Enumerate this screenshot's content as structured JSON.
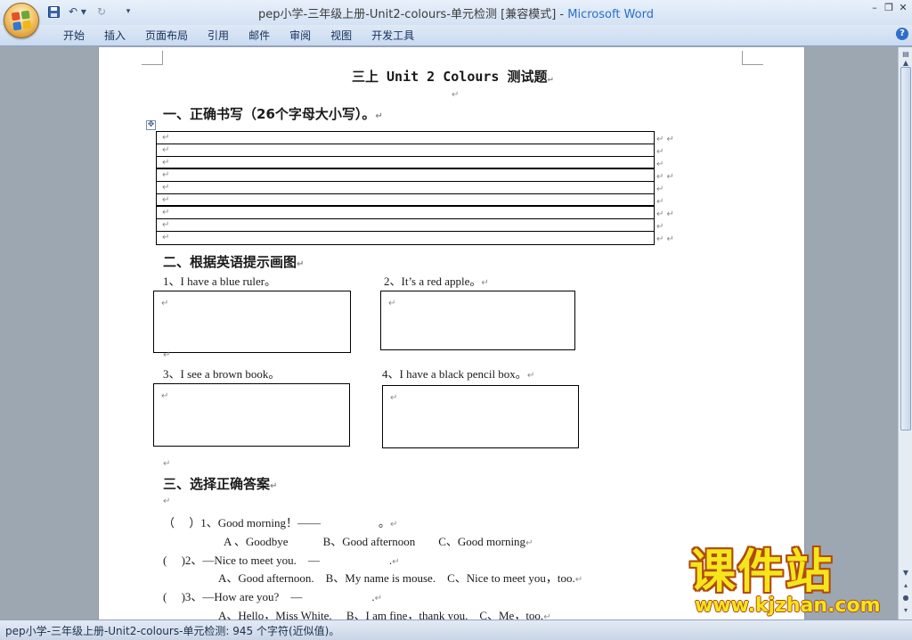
{
  "window": {
    "title_doc": "pep小学-三年级上册-Unit2-colours-单元检测 [兼容模式] - ",
    "title_app": "Microsoft Word"
  },
  "ribbon": {
    "tabs": [
      "开始",
      "插入",
      "页面布局",
      "引用",
      "邮件",
      "审阅",
      "视图",
      "开发工具"
    ]
  },
  "document": {
    "heading": "三上 Unit 2 Colours 测试题",
    "section1": {
      "title": "一、正确书写（26个字母大小写）。"
    },
    "section2": {
      "title": "二、根据英语提示画图",
      "items": [
        "1、I have a blue ruler。",
        "2、It’s a red apple。",
        "3、I see a brown book。",
        "4、I have a black pencil box。"
      ]
    },
    "section3": {
      "title": "三、选择正确答案",
      "questions": [
        {
          "stem": "（　 ）1、Good morning！——　　　　　。",
          "options": "A 、Goodbye　　　B、Good afternoon　　C、Good morning"
        },
        {
          "stem": "(　 )2、—Nice to meet you.　—　　　　　　.",
          "options": "A、Good afternoon.　B、My name is mouse.　C、Nice to meet you，too."
        },
        {
          "stem": "(　 )3、—How are you?　—　　　　　　.",
          "options": "A、Hello，Miss White.　 B、I am fine，thank you.　C、Me，too."
        }
      ]
    }
  },
  "status": {
    "text": "pep小学-三年级上册-Unit2-colours-单元检测: 945 个字符(近似值)。"
  },
  "watermark": {
    "brand": "课件站",
    "url": "www.kjzhan.com"
  },
  "colors": {
    "accent": "#2a6fc9",
    "watermark_fill": "#f5e51a",
    "watermark_outline": "#b04a10"
  }
}
